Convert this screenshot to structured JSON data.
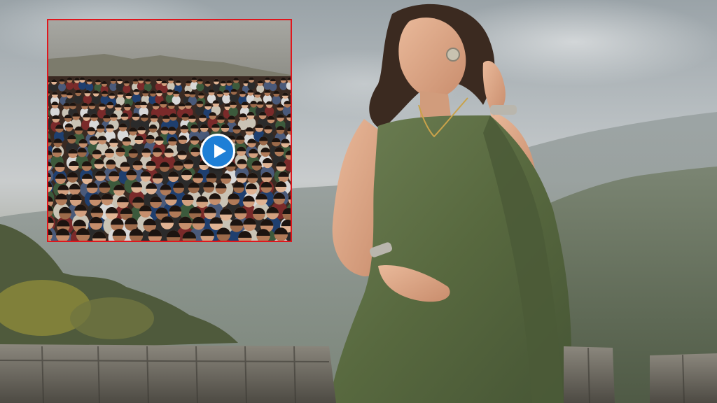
{
  "scene": {
    "description_free": true,
    "colors": {
      "sky": "#b9bfc2",
      "mountain": "#6f7a68",
      "saree": "#5d7046",
      "wall": "#6f6b62",
      "inset_border": "#e0161d",
      "play_button": "#1e7fd6"
    }
  },
  "inset": {
    "icon": "play-icon"
  }
}
